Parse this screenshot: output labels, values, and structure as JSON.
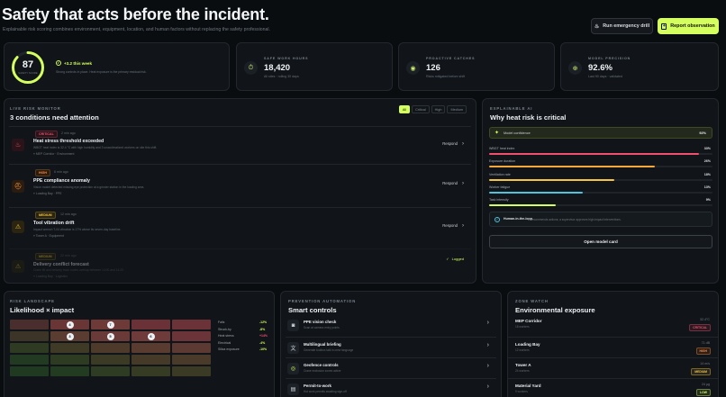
{
  "header": {
    "title": "Safety that acts before the incident.",
    "subtitle": "Explainable risk scoring combines environment, equipment, location, and human factors without replacing the safety professional.",
    "drill_label": "Run emergency drill",
    "report_label": "Report observation"
  },
  "score": {
    "value": "87",
    "caption": "SAFETY SCORE",
    "progress": 0.87,
    "trend": "+3.2 this week",
    "desc": "Strong controls in place. Heat exposure is the primary residual risk."
  },
  "kpis": [
    {
      "label": "SAFE WORK HOURS",
      "value": "18,420",
      "sub": "All sites · rolling 30 days",
      "icon": "stopwatch-icon"
    },
    {
      "label": "PROACTIVE CATCHES",
      "value": "126",
      "sub": "Risks mitigated before shift",
      "icon": "eye-icon"
    },
    {
      "label": "MODEL PRECISION",
      "value": "92.6%",
      "sub": "Last 90 days · validated",
      "icon": "precision-icon"
    }
  ],
  "radar": {
    "eyebrow": "LIVE RISK MONITOR",
    "title": "3 conditions need attention",
    "filters": [
      "All",
      "Critical",
      "High",
      "Medium"
    ],
    "active_filter": "All",
    "items": [
      {
        "level": "CRITICAL",
        "time": "2 min ago",
        "title": "Heat stress threshold exceeded",
        "desc": "WBGT heat index is 32.4 °C with high humidity and 3 unacclimatized workers on site this shift.",
        "loc": "MEP Corridor · Environment",
        "action": "Respond",
        "icon": "heat-icon"
      },
      {
        "level": "HIGH",
        "time": "6 min ago",
        "title": "PPE compliance anomaly",
        "desc": "Vision model detected missing eye protection at a grinder station in the loading area.",
        "loc": "Loading Bay · PPE",
        "action": "Respond",
        "icon": "ppe-icon"
      },
      {
        "level": "MEDIUM",
        "time": "12 min ago",
        "title": "Tool vibration drift",
        "desc": "Impact wrench T-04 vibration is 17% above its seven-day baseline.",
        "loc": "Tower A · Equipment",
        "action": "Respond",
        "icon": "warning-icon"
      },
      {
        "level": "MEDIUM",
        "time": "22 min ago",
        "title": "Delivery conflict forecast",
        "desc": "Crane lift and delivery truck routes overlap between 14:00 and 14:20.",
        "loc": "Loading Bay · Logistics",
        "action": "Logged",
        "icon": "warning-icon"
      }
    ]
  },
  "explain": {
    "eyebrow": "EXPLAINABLE AI",
    "title": "Why heat risk is critical",
    "confidence_label": "Model confidence",
    "confidence_value": "92%",
    "factors": [
      {
        "name": "WBGT heat index",
        "value": "33%",
        "pct": 0.94,
        "color": "#f0506e"
      },
      {
        "name": "Exposure duration",
        "value": "26%",
        "pct": 0.74,
        "color": "#f5a83a"
      },
      {
        "name": "Ventilation rate",
        "value": "18%",
        "pct": 0.56,
        "color": "#f5c542"
      },
      {
        "name": "Worker fatigue",
        "value": "13%",
        "pct": 0.42,
        "color": "#4ec3e0"
      },
      {
        "name": "Task intensity",
        "value": "9%",
        "pct": 0.3,
        "color": "#d4ff5e"
      }
    ],
    "note_title": "Human-in-the-loop.",
    "note_text": "AI recommends actions; a supervisor approves high-impact interventions.",
    "model_card_label": "Open model card"
  },
  "landscape": {
    "eyebrow": "RISK LANDSCAPE",
    "title": "Likelihood × impact",
    "bubbles": [
      {
        "label": "4",
        "row": 0,
        "col": 1
      },
      {
        "label": "7",
        "row": 0,
        "col": 2
      },
      {
        "label": "3",
        "row": 1,
        "col": 1
      },
      {
        "label": "5",
        "row": 1,
        "col": 2
      },
      {
        "label": "6",
        "row": 1,
        "col": 3
      }
    ],
    "legend": [
      {
        "name": "Falls",
        "value": "-12%",
        "color": "#d4ff5e"
      },
      {
        "name": "Struck-by",
        "value": "-8%",
        "color": "#d4ff5e"
      },
      {
        "name": "Heat stress",
        "value": "+14%",
        "color": "#f0506e"
      },
      {
        "name": "Electrical",
        "value": "-4%",
        "color": "#d4ff5e"
      },
      {
        "name": "Silica exposure",
        "value": "-10%",
        "color": "#d4ff5e"
      }
    ]
  },
  "controls": {
    "eyebrow": "PREVENTION AUTOMATION",
    "title": "Smart controls",
    "items": [
      {
        "name": "PPE vision check",
        "desc": "Scan at camera entry points",
        "icon": "camera-icon"
      },
      {
        "name": "Multilingual briefing",
        "desc": "Generate toolbox talk in crew language",
        "icon": "translate-icon"
      },
      {
        "name": "Geofence controls",
        "desc": "Crane exclusion zones active",
        "icon": "geofence-icon"
      },
      {
        "name": "Permit-to-work",
        "desc": "Hot work permits awaiting sign-off",
        "icon": "permit-icon"
      }
    ]
  },
  "zones": {
    "eyebrow": "ZONE WATCH",
    "title": "Environmental exposure",
    "items": [
      {
        "name": "MEP Corridor",
        "sub": "18 workers",
        "pct": "32.4°C",
        "tag": "CRITICAL",
        "color": "#f0506e"
      },
      {
        "name": "Loading Bay",
        "sub": "12 workers",
        "pct": "71 dB",
        "tag": "HIGH",
        "color": "#ff8a3d"
      },
      {
        "name": "Tower A",
        "sub": "24 workers",
        "pct": "14 m/s",
        "tag": "MEDIUM",
        "color": "#f5c542"
      },
      {
        "name": "Material Yard",
        "sub": "9 workers",
        "pct": "24 µg",
        "tag": "LOW",
        "color": "#d4ff5e"
      }
    ]
  }
}
